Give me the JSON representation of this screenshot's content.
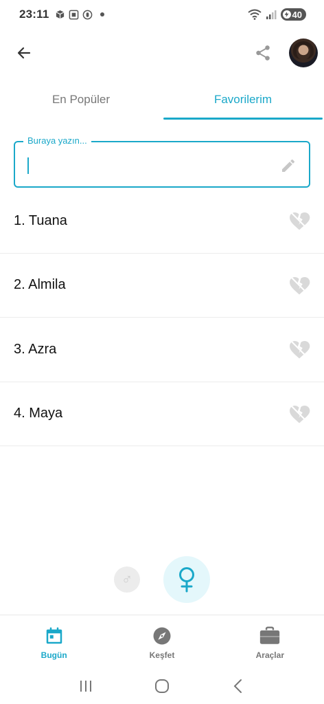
{
  "status_bar": {
    "time": "23:11",
    "battery": "40",
    "left_icons": [
      "package-icon",
      "screenshot-icon",
      "record-icon"
    ],
    "right_icons": [
      "wifi-icon",
      "signal-icon"
    ]
  },
  "app_bar": {
    "back_icon": "arrow-left-icon",
    "share_icon": "share-icon"
  },
  "tabs": [
    {
      "label": "En Popüler",
      "active": false
    },
    {
      "label": "Favorilerim",
      "active": true
    }
  ],
  "search": {
    "label": "Buraya yazın...",
    "value": "",
    "icon": "pencil-icon"
  },
  "favorites": [
    {
      "label": "1. Tuana"
    },
    {
      "label": "2. Almila"
    },
    {
      "label": "3. Azra"
    },
    {
      "label": "4. Maya"
    }
  ],
  "gender_toggle": {
    "male_symbol": "♂",
    "female_symbol": "♀",
    "selected": "female"
  },
  "bottom_nav": [
    {
      "label": "Bugün",
      "icon": "calendar-icon",
      "active": true
    },
    {
      "label": "Keşfet",
      "icon": "compass-icon",
      "active": false
    },
    {
      "label": "Araçlar",
      "icon": "briefcase-icon",
      "active": false
    }
  ],
  "colors": {
    "accent": "#1aa8c9",
    "inactive": "#777777",
    "heart_disabled": "#d9d9d9",
    "divider": "#ececec"
  }
}
